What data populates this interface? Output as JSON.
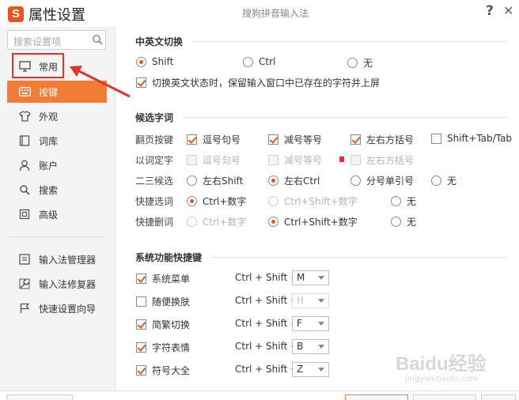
{
  "titlebar": {
    "title": "属性设置",
    "center_title": "搜狗拼音输入法",
    "help": "?",
    "logo": "S"
  },
  "sidebar": {
    "search_placeholder": "搜索设置项",
    "items": [
      {
        "label": "常用",
        "icon": "monitor-icon"
      },
      {
        "label": "按键",
        "icon": "keyboard-icon",
        "active": true
      },
      {
        "label": "外观",
        "icon": "shirt-icon"
      },
      {
        "label": "词库",
        "icon": "book-icon"
      },
      {
        "label": "账户",
        "icon": "user-icon"
      },
      {
        "label": "搜索",
        "icon": "search-icon"
      },
      {
        "label": "高级",
        "icon": "advanced-icon"
      }
    ],
    "tools": [
      {
        "label": "输入法管理器",
        "icon": "manager-icon"
      },
      {
        "label": "输入法修复器",
        "icon": "repair-icon"
      },
      {
        "label": "快速设置向导",
        "icon": "flag-icon"
      }
    ]
  },
  "cn_en_switch": {
    "title": "中英文切换",
    "options": [
      "Shift",
      "Ctrl",
      "无"
    ],
    "selected": "Shift",
    "commit_label": "切换英文状态时，保留输入窗口中已存在的字符并上屏"
  },
  "candidates": {
    "title": "候选字词",
    "page_turn": {
      "label": "翻页按键",
      "options": [
        "逗号句号",
        "减号等号",
        "左右方括号",
        "Shift+Tab/Tab"
      ]
    },
    "word_select": {
      "label": "以词定字",
      "options": [
        "逗号句号",
        "减号等号",
        "左右方括号"
      ]
    },
    "second_third": {
      "label": "二三候选",
      "options": [
        "左右Shift",
        "左右Ctrl",
        "分号单引号",
        "无"
      ],
      "selected": "左右Ctrl"
    },
    "quick_select": {
      "label": "快捷选词",
      "options": [
        "Ctrl+数字",
        "Ctrl+Shift+数字",
        "无"
      ],
      "selected": "Ctrl+数字"
    },
    "quick_delete": {
      "label": "快捷删词",
      "options": [
        "Ctrl+数字",
        "Ctrl+Shift+数字",
        "无"
      ],
      "selected": "Ctrl+Shift+数字"
    }
  },
  "system_shortcuts": {
    "title": "系统功能快捷键",
    "prefix": "Ctrl + Shift +",
    "items": [
      {
        "label": "系统菜单",
        "key": "M",
        "checked": true
      },
      {
        "label": "随便换肤",
        "key": "H",
        "checked": false
      },
      {
        "label": "简繁切换",
        "key": "F",
        "checked": true
      },
      {
        "label": "字符表情",
        "key": "B",
        "checked": true
      },
      {
        "label": "符号大全",
        "key": "Z",
        "checked": true
      }
    ]
  },
  "watermark": {
    "text": "Baidu经验",
    "url": "jingyan.baidu.com"
  },
  "colors": {
    "accent": "#f07c36",
    "highlight_red": "#e0332b",
    "check": "#e8541f"
  }
}
